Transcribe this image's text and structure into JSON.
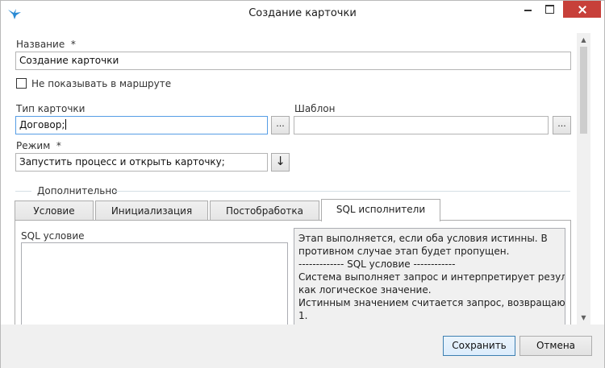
{
  "window": {
    "title": "Создание карточки",
    "icon": "bird-app-icon"
  },
  "form": {
    "name_label": "Название",
    "required_mark": "*",
    "name_value": "Создание карточки",
    "hide_in_route_label": "Не показывать в маршруте",
    "hide_in_route_checked": false,
    "card_type_label": "Тип карточки",
    "card_type_value": "Договор;",
    "template_label": "Шаблон",
    "template_value": "",
    "browse_label": "...",
    "mode_label": "Режим",
    "mode_value": "Запустить процесс и открыть карточку;",
    "mode_dropdown_glyph": "↓",
    "additional_label": "Дополнительно"
  },
  "tabs": [
    {
      "label": "Условие",
      "active": false
    },
    {
      "label": "Инициализация",
      "active": false
    },
    {
      "label": "Постобработка",
      "active": false
    },
    {
      "label": "SQL исполнители",
      "active": true
    }
  ],
  "tab_panel": {
    "sql_condition_label": "SQL условие",
    "sql_condition_value": "",
    "info_lines": [
      "Этап выполняется, если оба условия истинны. В",
      "противном случае этап будет пропущен.",
      "------------- SQL условие ------------",
      "Система выполняет запрос и интерпретирует результат",
      "как логическое значение.",
      "Истинным значением считается запрос, возвращающий",
      "1."
    ]
  },
  "footer": {
    "save_label": "Сохранить",
    "cancel_label": "Отмена"
  },
  "colors": {
    "close_button": "#c7403a",
    "focus_border": "#569de5",
    "default_button_border": "#3c7fb1"
  }
}
